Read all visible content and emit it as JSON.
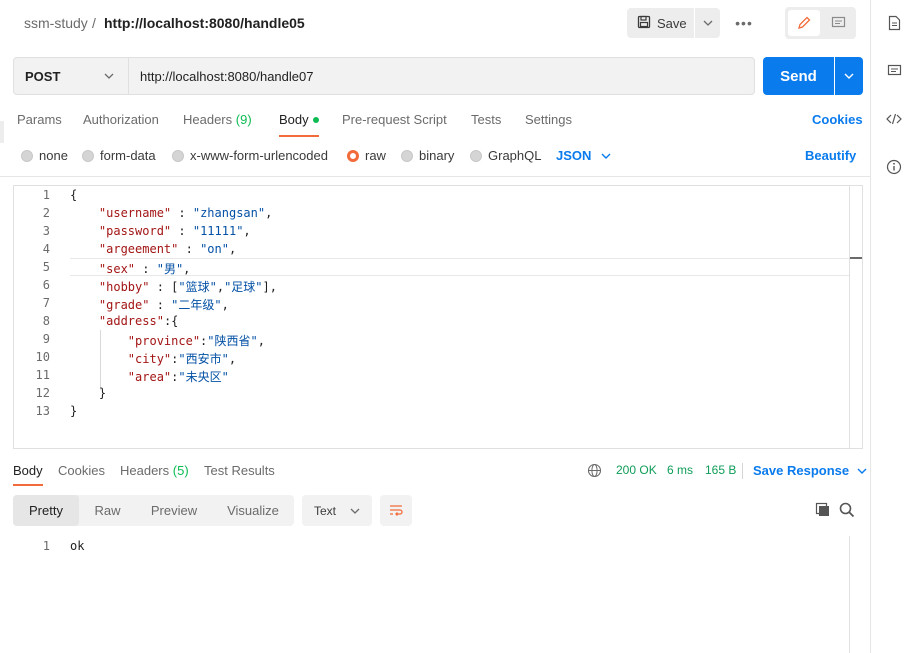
{
  "header": {
    "breadcrumb_parent": "ssm-study",
    "breadcrumb_sep": "/",
    "breadcrumb_current": "http://localhost:8080/handle05",
    "save_label": "Save",
    "more_label": "•••"
  },
  "request": {
    "method": "POST",
    "url": "http://localhost:8080/handle07",
    "send_label": "Send"
  },
  "req_tabs": {
    "params": "Params",
    "authorization": "Authorization",
    "headers": "Headers",
    "headers_count": "(9)",
    "body": "Body",
    "prerequest": "Pre-request Script",
    "tests": "Tests",
    "settings": "Settings",
    "cookies": "Cookies"
  },
  "body_types": {
    "none": "none",
    "form_data": "form-data",
    "urlencoded": "x-www-form-urlencoded",
    "raw": "raw",
    "binary": "binary",
    "graphql": "GraphQL",
    "format": "JSON",
    "beautify": "Beautify"
  },
  "editor": {
    "line_numbers": [
      "1",
      "2",
      "3",
      "4",
      "5",
      "6",
      "7",
      "8",
      "9",
      "10",
      "11",
      "12",
      "13"
    ],
    "l1": "{",
    "l2_key": "\"username\"",
    "l2_val": "\"zhangsan\"",
    "l3_key": "\"password\"",
    "l3_val": "\"11111\"",
    "l4_key": "\"argeement\"",
    "l4_val": "\"on\"",
    "l5_key": "\"sex\"",
    "l5_val": "\"男\"",
    "l6_key": "\"hobby\"",
    "l6_val1": "\"篮球\"",
    "l6_val2": "\"足球\"",
    "l7_key": "\"grade\"",
    "l7_val": "\"二年级\"",
    "l8_key": "\"address\"",
    "l9_key": "\"province\"",
    "l9_val": "\"陕西省\"",
    "l10_key": "\"city\"",
    "l10_val": "\"西安市\"",
    "l11_key": "\"area\"",
    "l11_val": "\"未央区\"",
    "l12": "}",
    "l13": "}"
  },
  "response": {
    "tab_body": "Body",
    "tab_cookies": "Cookies",
    "tab_headers": "Headers",
    "headers_count": "(5)",
    "tab_tests": "Test Results",
    "status": "200 OK",
    "time": "6 ms",
    "size": "165 B",
    "save_response": "Save Response",
    "fmt_pretty": "Pretty",
    "fmt_raw": "Raw",
    "fmt_preview": "Preview",
    "fmt_visualize": "Visualize",
    "text_format": "Text",
    "line_number": "1",
    "content": "ok"
  },
  "colors": {
    "accent_blue": "#097bed",
    "accent_orange": "#f26b3a",
    "status_green": "#0cbb52"
  }
}
